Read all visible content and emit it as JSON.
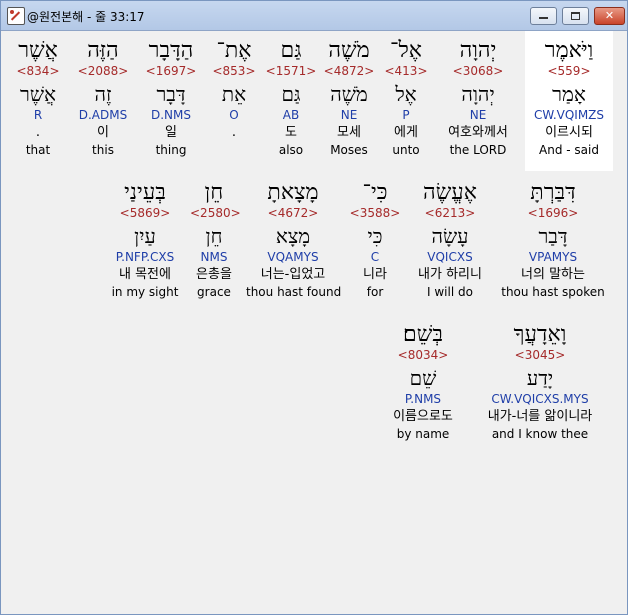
{
  "window": {
    "title": "@원전본해 - 줄 33:17"
  },
  "rows": [
    [
      {
        "heb": "אֲשֶׁר",
        "num": "<834>",
        "lemma": "אֲשֶׁר",
        "morph": "R",
        "ko": "",
        "en": "that"
      },
      {
        "heb": "הַזֶּה",
        "num": "<2088>",
        "lemma": "זֶה",
        "morph": "D.ADMS",
        "ko": "이",
        "en": "this"
      },
      {
        "heb": "הַדָּבָר",
        "num": "<1697>",
        "lemma": "דָּבָר",
        "morph": "D.NMS",
        "ko": "일",
        "en": "thing"
      },
      {
        "heb": "אֶת־",
        "num": "<853>",
        "lemma": "אֵת",
        "morph": "O",
        "ko": "",
        "en": ""
      },
      {
        "heb": "גַּם",
        "num": "<1571>",
        "lemma": "גַּם",
        "morph": "AB",
        "ko": "도",
        "en": "also"
      },
      {
        "heb": "מֹשֶׁה",
        "num": "<4872>",
        "lemma": "מֹשֶׁה",
        "morph": "NE",
        "ko": "모세",
        "en": "Moses"
      },
      {
        "heb": "אֶל־",
        "num": "<413>",
        "lemma": "אֶל",
        "morph": "P",
        "ko": "에게",
        "en": "unto"
      },
      {
        "heb": "יְהוָה",
        "num": "<3068>",
        "lemma": "יְהוָה",
        "morph": "NE",
        "ko": "여호와께서",
        "en": "the LORD"
      },
      {
        "heb": "וַיֹּאמֶר",
        "num": "<559>",
        "lemma": "אָמַר",
        "morph": "CW.VQIMZS",
        "ko": "이르시되",
        "en": "And - said",
        "selected": true
      }
    ],
    [
      {
        "heb": "בְּעֵינַי",
        "num": "<5869>",
        "lemma": "עַיִן",
        "morph": "P.NFP.CXS",
        "ko": "내 목전에",
        "en": "in my sight"
      },
      {
        "heb": "חֵן",
        "num": "<2580>",
        "lemma": "חֵן",
        "morph": "NMS",
        "ko": "은총을",
        "en": "grace"
      },
      {
        "heb": "מָצָאתָ",
        "num": "<4672>",
        "lemma": "מָצָא",
        "morph": "VQAMYS",
        "ko": "너는-입었고",
        "en": "thou hast found"
      },
      {
        "heb": "כִּי־",
        "num": "<3588>",
        "lemma": "כִּי",
        "morph": "C",
        "ko": "니라",
        "en": "for"
      },
      {
        "heb": "אֶעֱשֶׂה",
        "num": "<6213>",
        "lemma": "עָשָׂה",
        "morph": "VQICXS",
        "ko": "내가 하리니",
        "en": "I will do"
      },
      {
        "heb": "דִּבַּרְתָּ",
        "num": "<1696>",
        "lemma": "דָּבַר",
        "morph": "VPAMYS",
        "ko": "너의 말하는",
        "en": "thou hast spoken"
      }
    ],
    [
      {
        "heb": "בְּשֵׁם׃",
        "num": "<8034>",
        "lemma": "שֵׁם",
        "morph": "P.NMS",
        "ko": "이름으로도",
        "en": "by name"
      },
      {
        "heb": "וָאֵדָעֲךָ",
        "num": "<3045>",
        "lemma": "יָדַע",
        "morph": "CW.VQICXS.MYS",
        "ko": "내가-너를 앎이니라",
        "en": "and I know thee"
      }
    ]
  ],
  "dots": {
    "r0c0": ".",
    "r0c3": "."
  }
}
